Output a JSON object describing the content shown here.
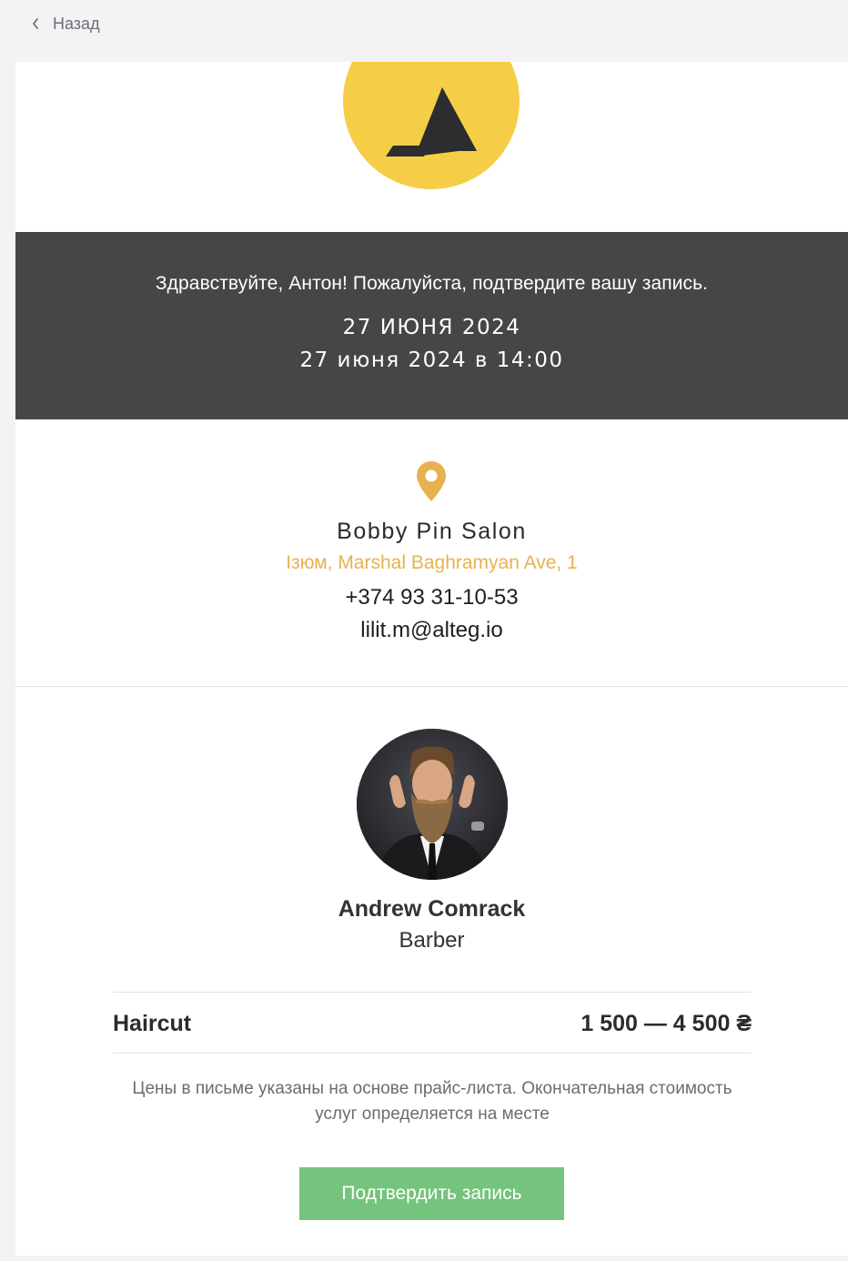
{
  "nav": {
    "back_label": "Назад",
    "back_icon": "chevron-left-icon"
  },
  "brand": {
    "logo": "brand-logo",
    "logo_color": "#f6cd46",
    "mark_color": "#2b2d2e"
  },
  "hero": {
    "greeting": "Здравствуйте, Антон! Пожалуйста, подтвердите вашу запись.",
    "date_upper": "27 ИЮНЯ 2024",
    "date_time": "27 июня 2024 в 14:00",
    "background": "#464646"
  },
  "location": {
    "icon": "map-pin-icon",
    "name": "Bobby Pin Salon",
    "address": "Ізюм, Marshal Baghramyan Ave, 1",
    "phone": "+374 93 31-10-53",
    "email": "lilit.m@alteg.io",
    "accent": "#e6b24f"
  },
  "staff": {
    "name": "Andrew Comrack",
    "role": "Barber"
  },
  "service": {
    "name": "Haircut",
    "price": "1 500 — 4 500 ₴"
  },
  "note": "Цены в письме указаны на основе прайс-листа. Окончательная стоимость услуг определяется на месте",
  "actions": {
    "confirm_label": "Подтвердить запись",
    "confirm_color": "#74c47d"
  }
}
